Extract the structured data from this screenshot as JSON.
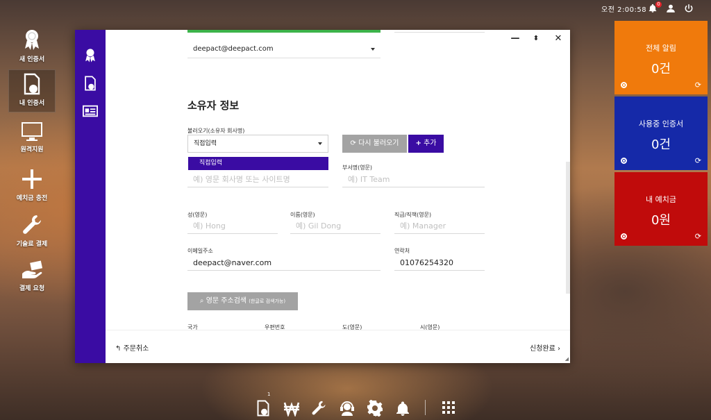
{
  "topbar": {
    "clock": "오전 2:00:58",
    "notification_count": "0"
  },
  "desktop": {
    "items": [
      {
        "label": "새 인증서",
        "icon": "award-ribbon-icon"
      },
      {
        "label": "내 인증서",
        "icon": "certificate-document-icon"
      },
      {
        "label": "원격지원",
        "icon": "monitor-icon"
      },
      {
        "label": "예치금 충전",
        "icon": "plus-icon"
      },
      {
        "label": "기술료 결제",
        "icon": "wrench-icon"
      },
      {
        "label": "결제 요청",
        "icon": "hand-card-icon"
      }
    ]
  },
  "tiles": [
    {
      "title": "전체 알림",
      "value": "0건",
      "color": "#f07a0c"
    },
    {
      "title": "사용중 인증서",
      "value": "0건",
      "color": "#1529a8"
    },
    {
      "title": "내 예치금",
      "value": "0원",
      "color": "#c00b0b"
    }
  ],
  "dialog": {
    "top_email_select": "deepact@deepact.com",
    "section_title": "소유자 정보",
    "loader_label": "불러오기(소유자 회사명)",
    "loader_value": "직접입력",
    "dropdown_option": "직접입력",
    "reload_button": "다시 불러오기",
    "add_button": "추가",
    "company_placeholder": "예) 영문 회사명 또는 사이트명",
    "department_label": "부서명(영문)",
    "department_placeholder": "예) IT Team",
    "last_name_label": "성(영문)",
    "last_name_placeholder": "예) Hong",
    "first_name_label": "이름(영문)",
    "first_name_placeholder": "예) Gil Dong",
    "position_label": "직급/직책(영문)",
    "position_placeholder": "예) Manager",
    "email_label": "이메일주소",
    "email_value": "deepact@naver.com",
    "phone_label": "연락처",
    "phone_value": "01076254320",
    "address_search_button": "영문 주소검색",
    "address_search_hint": "(한글로 검색가능)",
    "country_label": "국가",
    "zip_label": "우편번호",
    "province_label": "도(영문)",
    "city_label": "시(영문)",
    "cancel_order": "주문취소",
    "submit": "신청완료"
  },
  "taskbar": {
    "cert_count": "1"
  },
  "colors": {
    "accent": "#3a0ca3",
    "grey_button": "#a3a3a3"
  }
}
